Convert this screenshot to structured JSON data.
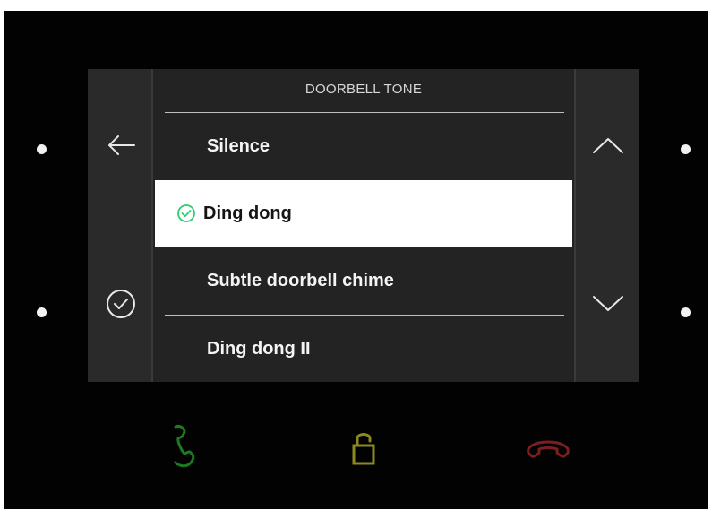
{
  "screen": {
    "title": "DOORBELL TONE",
    "back_icon": "arrow-left-icon",
    "confirm_icon": "check-circle-icon",
    "scroll_up_icon": "chevron-up-icon",
    "scroll_down_icon": "chevron-down-icon"
  },
  "tones": [
    {
      "label": "Silence",
      "selected": false
    },
    {
      "label": "Ding dong",
      "selected": true
    },
    {
      "label": "Subtle doorbell chime",
      "selected": false
    },
    {
      "label": "Ding dong II",
      "selected": false
    }
  ],
  "hardware_buttons": {
    "answer_icon": "phone-answer-icon",
    "unlock_icon": "unlock-icon",
    "hangup_icon": "phone-hangup-icon"
  },
  "colors": {
    "selected_row_bg": "#ffffff",
    "check_green": "#2ecc71",
    "answer_green": "#1f7a1f",
    "unlock_olive": "#8c8a1e",
    "hangup_red": "#7a1f1f",
    "screen_bg": "#232323"
  }
}
